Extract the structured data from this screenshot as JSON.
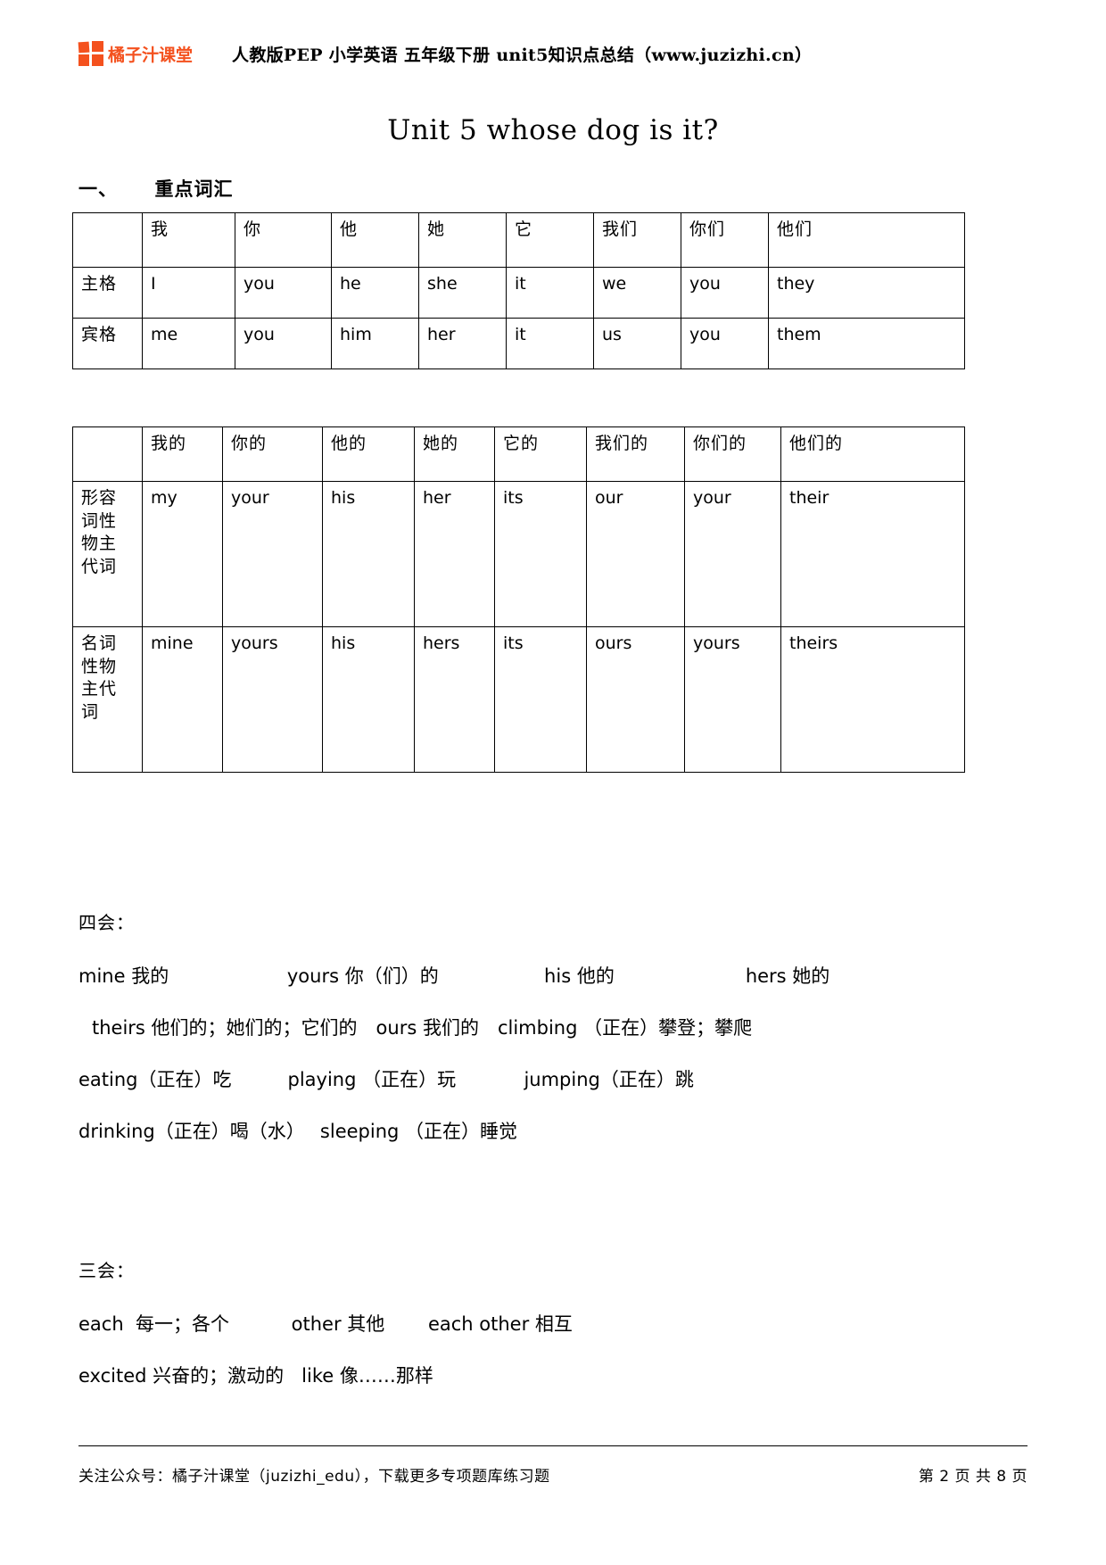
{
  "header": {
    "logo_text": "橘子汁课堂",
    "logo_color": "#F4511E",
    "title": "人教版PEP 小学英语 五年级下册  unit5知识点总结（www.juzizhi.cn）"
  },
  "doc": {
    "title": "Unit 5 whose dog is it?",
    "section_one_heading": "一、     重点词汇"
  },
  "table_pronoun_case": {
    "headers": [
      "",
      "我",
      "你",
      "他",
      "她",
      "它",
      "我们",
      "你们",
      "他们"
    ],
    "rows": [
      {
        "label": "主格",
        "cells": [
          "I",
          "you",
          "he",
          "she",
          "it",
          "we",
          "you",
          "they"
        ]
      },
      {
        "label": "宾格",
        "cells": [
          "me",
          "you",
          "him",
          "her",
          "it",
          "us",
          "you",
          "them"
        ]
      }
    ]
  },
  "table_possessive": {
    "headers": [
      "",
      "我的",
      "你的",
      "他的",
      "她的",
      "它的",
      "我们的",
      "你们的",
      "他们的"
    ],
    "rows": [
      {
        "label": "形容词性物主代词",
        "cells": [
          "my",
          "your",
          "his",
          "her",
          "its",
          "our",
          "your",
          "their"
        ]
      },
      {
        "label": "名词性物主代词",
        "cells": [
          "mine",
          "yours",
          "his",
          "hers",
          "its",
          "ours",
          "yours",
          "theirs"
        ]
      }
    ]
  },
  "sihui": {
    "label": "四会：",
    "lines": [
      "mine 我的　　　　　　 yours 你（们）的　　　　　  his 他的　　　　　　　hers 她的",
      "theirs 他们的；她们的；它们的　ours 我们的　climbing （正在）攀登；攀爬",
      "eating（正在）吃　　　playing （正在）玩　　　  jumping（正在）跳",
      "drinking（正在）喝（水）　 sleeping （正在）睡觉"
    ]
  },
  "sanhui": {
    "label": "三会：",
    "lines": [
      "each  每一；各个　　　 other 其他　　 each other 相互",
      "excited 兴奋的；激动的   like 像……那样"
    ]
  },
  "footer": {
    "left": "关注公众号：橘子汁课堂（juzizhi_edu），下载更多专项题库练习题",
    "right": "第 2 页 共 8 页"
  }
}
